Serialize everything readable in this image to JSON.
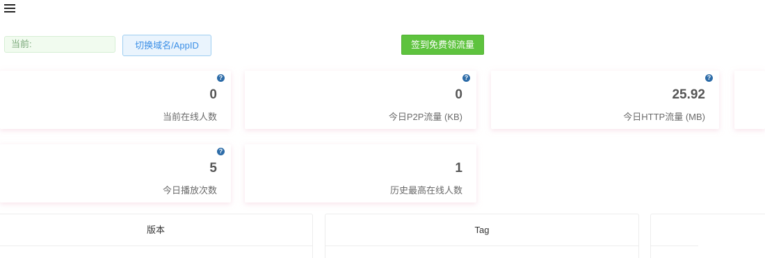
{
  "header": {
    "menu_icon": "hamburger-menu-icon"
  },
  "toolbar": {
    "current_label": "当前:",
    "switch_label": "切换域名/AppID",
    "signin_label": "签到免费领流量",
    "signin_color": "#5ec33e",
    "switch_color": "#3a8ee6"
  },
  "stats": [
    {
      "value": "0",
      "label": "当前在线人数",
      "has_help": true
    },
    {
      "value": "0",
      "label": "今日P2P流量 (KB)",
      "has_help": true
    },
    {
      "value": "25.92",
      "label": "今日HTTP流量 (MB)",
      "has_help": true
    },
    {
      "value": "",
      "label": "",
      "has_help": false
    },
    {
      "value": "5",
      "label": "今日播放次数",
      "has_help": true
    },
    {
      "value": "1",
      "label": "历史最高在线人数",
      "has_help": false
    }
  ],
  "help_icon": {
    "glyph": "?",
    "color": "#2d6ca8"
  },
  "panels": [
    {
      "title": "版本"
    },
    {
      "title": "Tag"
    },
    {
      "title": ""
    }
  ]
}
